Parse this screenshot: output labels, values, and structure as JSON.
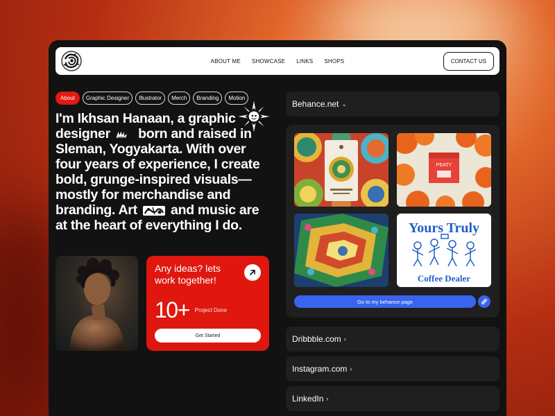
{
  "nav": {
    "links": [
      "ABOUT ME",
      "SHOWCASE",
      "LINKS",
      "SHOPS"
    ],
    "contact_label": "CONTACT US"
  },
  "tags": [
    "About",
    "Graphic Designer",
    "Illustrator",
    "Merch",
    "Branding",
    "Motion"
  ],
  "bio": {
    "part1": "I'm Ikhsan Hanaan, a graphic designer",
    "part2": "born and raised in Sleman, Yogyakarta. With over four years of experience, I create bold, grunge-inspired visuals—mostly for merchandise and branding. Art",
    "part3": "and music are at the heart of everything I do."
  },
  "cta": {
    "title": "Any ideas? lets work together!",
    "stat_value": "10+",
    "stat_label": "Project Done",
    "button_label": "Get Started"
  },
  "behance": {
    "label": "Behance.net",
    "button_label": "Go to my behance page",
    "yours_truly": "Yours Truly",
    "coffee_dealer": "Coffee Dealer",
    "packaging_brand": "PEATY"
  },
  "links": {
    "dribbble": "Dribbble.com",
    "instagram": "Instagram.com",
    "linkedin": "LinkedIn"
  },
  "colors": {
    "accent_red": "#e0170f",
    "behance_blue": "#3a63f0",
    "panel": "#1f1f1f",
    "frame": "#121212"
  }
}
